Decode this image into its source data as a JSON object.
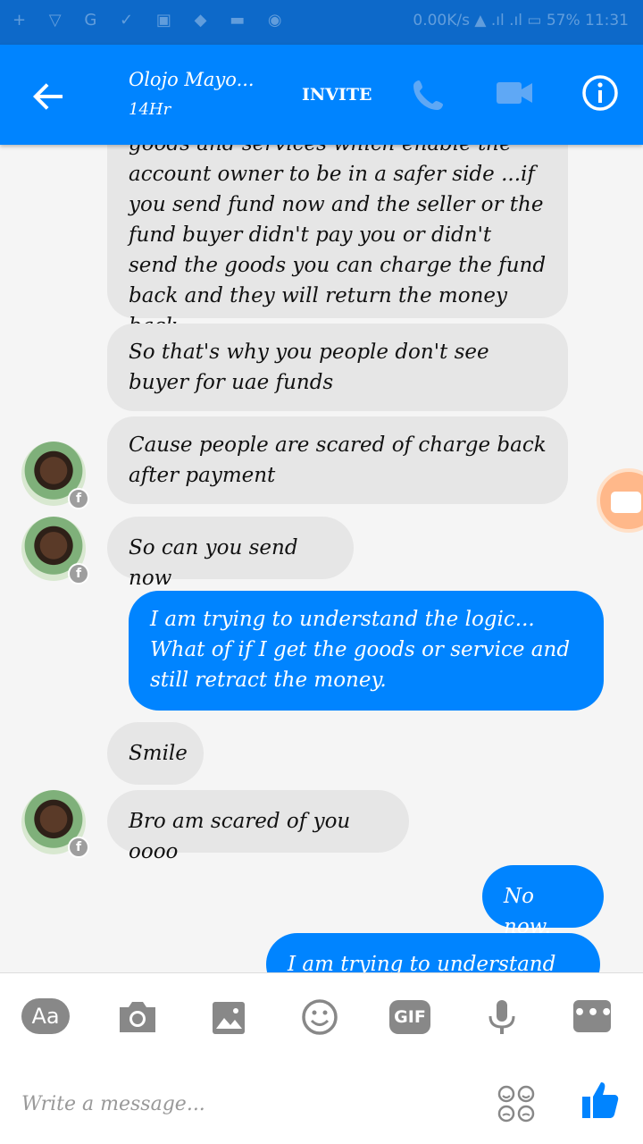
{
  "status_bar": {
    "left_icons": "+ ▽ G ✓ ▣ ◆ ▬ ◉",
    "right_text": "0.00K/s  ▲ .ıl .ıl ▭ 57%  11:31"
  },
  "header": {
    "contact_name": "Olojo Mayo...",
    "contact_status": "14Hr",
    "invite_label": "INVITE"
  },
  "messages": [
    {
      "sender": "them",
      "text": "goods and services which enable the account owner to be in a safer side ...if you send fund now and the seller or the fund buyer didn't pay you or didn't send the goods you can charge the fund back and they will return the money back"
    },
    {
      "sender": "them",
      "text": "So that's why you people don't see buyer for uae  funds"
    },
    {
      "sender": "them",
      "text": "Cause people are scared of charge back after payment"
    },
    {
      "sender": "them",
      "text": "So can you send now"
    },
    {
      "sender": "me",
      "text": "I am trying to understand the logic...  What of if I get the goods or service and still retract the money."
    },
    {
      "sender": "them",
      "text": "Smile"
    },
    {
      "sender": "them",
      "text": "Bro am scared of you oooo"
    },
    {
      "sender": "me",
      "text": "No now."
    },
    {
      "sender": "me",
      "text": "I am trying to understand you."
    }
  ],
  "avatar_badge": "f",
  "composer": {
    "aa_label": "Aa",
    "gif_label": "GIF",
    "more_label": "•••",
    "placeholder": "Write a message..."
  },
  "colors": {
    "header": "#0084ff",
    "status_bar": "#0d69c9",
    "incoming_bubble": "#e6e6e6",
    "outgoing_bubble": "#0084ff"
  }
}
